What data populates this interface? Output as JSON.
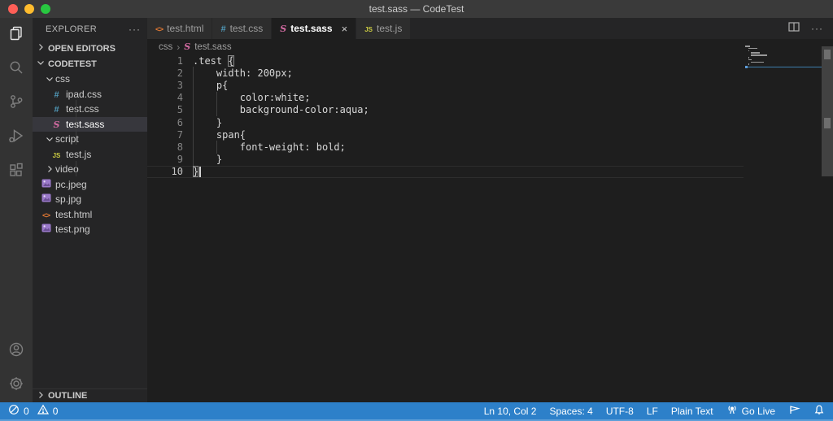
{
  "window": {
    "title": "test.sass — CodeTest"
  },
  "activity_bar": {
    "items": [
      {
        "id": "explorer",
        "icon": "files-icon",
        "active": true
      },
      {
        "id": "search",
        "icon": "search-icon",
        "active": false
      },
      {
        "id": "source-control",
        "icon": "source-control-icon",
        "active": false
      },
      {
        "id": "run-debug",
        "icon": "run-debug-icon",
        "active": false
      },
      {
        "id": "extensions",
        "icon": "extensions-icon",
        "active": false
      }
    ],
    "bottom_items": [
      {
        "id": "account",
        "icon": "account-icon",
        "active": false
      },
      {
        "id": "settings",
        "icon": "gear-icon",
        "active": false
      }
    ]
  },
  "sidebar": {
    "title": "EXPLORER",
    "more_label": "···",
    "open_editors_label": "OPEN EDITORS",
    "folder_label": "CODETEST",
    "outline_label": "OUTLINE",
    "tree": [
      {
        "label": "css",
        "kind": "folder",
        "chevron": "down",
        "level": 1
      },
      {
        "label": "ipad.css",
        "kind": "file",
        "icon": "css",
        "level": 2
      },
      {
        "label": "test.css",
        "kind": "file",
        "icon": "css",
        "level": 2
      },
      {
        "label": "test.sass",
        "kind": "file",
        "icon": "sass",
        "level": 2,
        "selected": true
      },
      {
        "label": "script",
        "kind": "folder",
        "chevron": "down",
        "level": 1
      },
      {
        "label": "test.js",
        "kind": "file",
        "icon": "js",
        "level": 2
      },
      {
        "label": "video",
        "kind": "folder",
        "chevron": "right",
        "level": 1
      },
      {
        "label": "pc.jpeg",
        "kind": "file",
        "icon": "image",
        "level": 1
      },
      {
        "label": "sp.jpg",
        "kind": "file",
        "icon": "image",
        "level": 1
      },
      {
        "label": "test.html",
        "kind": "file",
        "icon": "html",
        "level": 1
      },
      {
        "label": "test.png",
        "kind": "file",
        "icon": "image",
        "level": 1
      }
    ]
  },
  "tabs": [
    {
      "label": "test.html",
      "icon": "html",
      "active": false
    },
    {
      "label": "test.css",
      "icon": "css",
      "active": false
    },
    {
      "label": "test.sass",
      "icon": "sass",
      "active": true,
      "close_label": "×"
    },
    {
      "label": "test.js",
      "icon": "js",
      "active": false
    }
  ],
  "editor": {
    "breadcrumb": [
      {
        "label": "css"
      },
      {
        "label": "test.sass",
        "icon": "sass"
      }
    ],
    "lines": [
      {
        "num": "1",
        "before": ".test ",
        "bracket": "{"
      },
      {
        "num": "2",
        "before": "    width: 200px;"
      },
      {
        "num": "3",
        "before": "    p{"
      },
      {
        "num": "4",
        "before": "        color:white;"
      },
      {
        "num": "5",
        "before": "        background-color:aqua;"
      },
      {
        "num": "6",
        "before": "    }"
      },
      {
        "num": "7",
        "before": "    span{"
      },
      {
        "num": "8",
        "before": "        font-weight: bold;"
      },
      {
        "num": "9",
        "before": "    }"
      },
      {
        "num": "10",
        "before": "",
        "bracket": "}",
        "cursor": true,
        "current": true
      }
    ]
  },
  "status_bar": {
    "left": [
      {
        "id": "errors",
        "icon": "error-circle-icon",
        "label": "0"
      },
      {
        "id": "warnings",
        "icon": "warning-triangle-icon",
        "label": "0"
      }
    ],
    "right": [
      {
        "id": "cursor-position",
        "label": "Ln 10, Col 2"
      },
      {
        "id": "indentation",
        "label": "Spaces: 4"
      },
      {
        "id": "encoding",
        "label": "UTF-8"
      },
      {
        "id": "eol",
        "label": "LF"
      },
      {
        "id": "language-mode",
        "label": "Plain Text"
      },
      {
        "id": "go-live",
        "icon": "broadcast-icon",
        "label": "Go Live"
      },
      {
        "id": "feedback",
        "icon": "feedback-icon",
        "label": ""
      },
      {
        "id": "notifications",
        "icon": "bell-icon",
        "label": ""
      }
    ]
  },
  "colors": {
    "statusbar": "#2d80c9",
    "titlebar": "#3a3a3a",
    "activitybar": "#333333",
    "sidebar": "#252526",
    "editor": "#1e1e1e",
    "selection": "#37373d",
    "sass_pink": "#d36ba2",
    "css_blue": "#519aba",
    "js_yellow": "#cbcb41",
    "html_orange": "#e37933",
    "image_purple": "#9a79c9"
  }
}
